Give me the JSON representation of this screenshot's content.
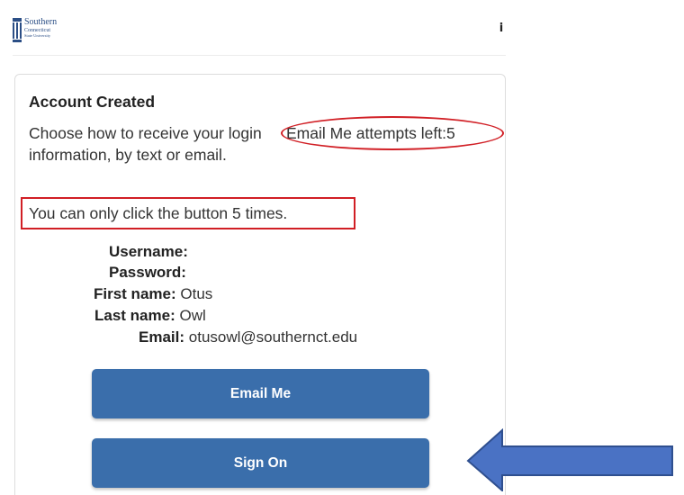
{
  "header": {
    "logo_line1": "Southern",
    "logo_line2": "Connecticut",
    "logo_line3": "State University",
    "info_icon": "info-icon"
  },
  "card": {
    "title": "Account Created",
    "instructions": "Choose how to receive your login information, by text or email.",
    "attempts_text": "Email Me attempts left:5",
    "limit_text": "You can only click the button 5 times.",
    "fields": [
      {
        "label": "Username:",
        "value": ""
      },
      {
        "label": "Password:",
        "value": ""
      },
      {
        "label": "First name:",
        "value": "Otus"
      },
      {
        "label": "Last name:",
        "value": "Owl"
      },
      {
        "label": "Email:",
        "value": "otusowl@southernct.edu"
      }
    ],
    "email_button": "Email Me",
    "signon_button": "Sign On"
  },
  "colors": {
    "button_blue": "#3a6eab",
    "annotation_red": "#d11f25",
    "arrow_fill": "#4a72c4",
    "arrow_stroke": "#2f4f8f"
  }
}
